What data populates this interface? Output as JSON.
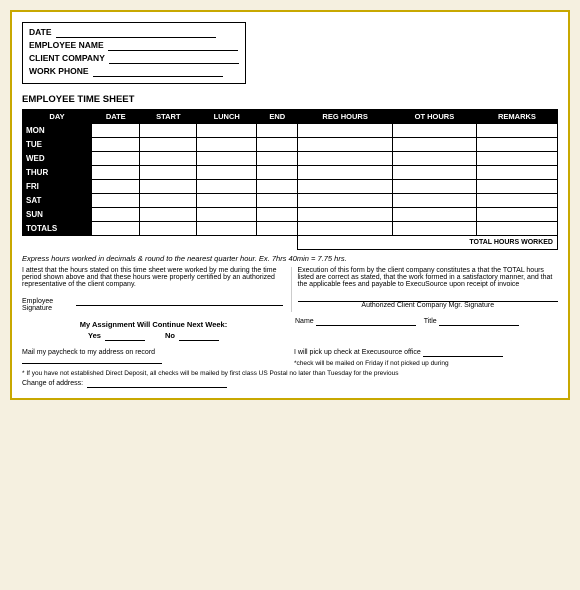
{
  "header": {
    "date_label": "DATE",
    "employee_name_label": "EMPLOYEE NAME",
    "client_company_label": "CLIENT COMPANY",
    "work_phone_label": "WORK PHONE",
    "section_title": "EMPLOYEE TIME SHEET"
  },
  "table": {
    "columns": [
      "DAY",
      "DATE",
      "START",
      "LUNCH",
      "END",
      "REG HOURS",
      "OT HOURS",
      "REMARKS"
    ],
    "rows": [
      "MON",
      "TUE",
      "WED",
      "THUR",
      "FRI",
      "SAT",
      "SUN",
      "TOTALS"
    ],
    "total_label": "TOTAL HOURS WORKED"
  },
  "express_note": "Express hours worked in decimals & round to the nearest quarter hour.  Ex.  7hrs 40min = 7.75 hrs.",
  "attestation": {
    "left_text": "I attest that the hours stated on this time sheet were worked by me during the time period shown above and that these hours were properly certified by an authorized representative of the client company.",
    "employee_sig_label": "Employee Signature",
    "right_text": "Execution of this form by the client company constitutes a that the TOTAL hours listed are correct as stated, that the work formed in a satisfactory manner, and that the applicable fees and payable to ExecuSource upon receipt of invoice",
    "auth_sig_label": "Authorized Client Company Mgr. Signature"
  },
  "continue_section": {
    "title": "My Assignment Will Continue Next Week:",
    "yes_label": "Yes",
    "no_label": "No"
  },
  "name_title": {
    "name_label": "Name",
    "title_label": "Title"
  },
  "mail_section": {
    "left_label": "Mail my paycheck to my address on record",
    "right_label": "I will pick up check at Execusource office",
    "notice1": "*check will be mailed on Friday if not picked up during",
    "notice2": "* If you have not established Direct Deposit, all checks will be mailed by first class US Postal no later than Tuesday for the previous"
  },
  "change_address": {
    "label": "Change of address:"
  }
}
